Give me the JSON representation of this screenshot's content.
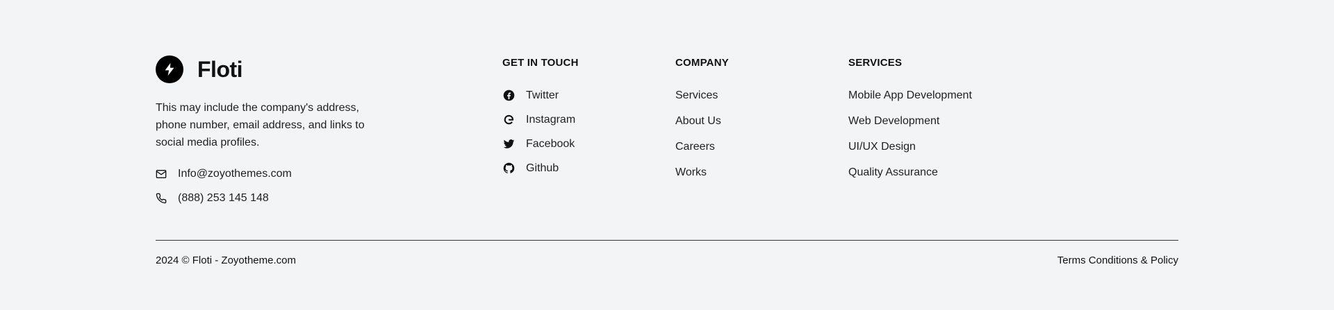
{
  "brand": {
    "name": "Floti",
    "description": "This may include the company's address, phone number, email address, and links to social media profiles.",
    "logo_icon": "bolt-icon"
  },
  "contact": {
    "email": "Info@zoyothemes.com",
    "email_icon": "mail-icon",
    "phone": "(888) 253 145 148",
    "phone_icon": "phone-icon"
  },
  "get_in_touch": {
    "title": "GET IN TOUCH",
    "items": [
      {
        "label": "Twitter",
        "icon": "facebook-icon"
      },
      {
        "label": "Instagram",
        "icon": "google-icon"
      },
      {
        "label": "Facebook",
        "icon": "twitter-icon"
      },
      {
        "label": "Github",
        "icon": "github-icon"
      }
    ]
  },
  "company": {
    "title": "COMPANY",
    "items": [
      "Services",
      "About Us",
      "Careers",
      "Works"
    ]
  },
  "services": {
    "title": "SERVICES",
    "items": [
      "Mobile App Development",
      "Web Development",
      "UI/UX Design",
      "Quality Assurance"
    ]
  },
  "bottom": {
    "copyright": "2024 © Floti - Zoyotheme.com",
    "terms": "Terms Conditions & Policy"
  },
  "colors": {
    "background": "#f3f4f6",
    "text": "#111111",
    "logo_bg": "#000000"
  }
}
